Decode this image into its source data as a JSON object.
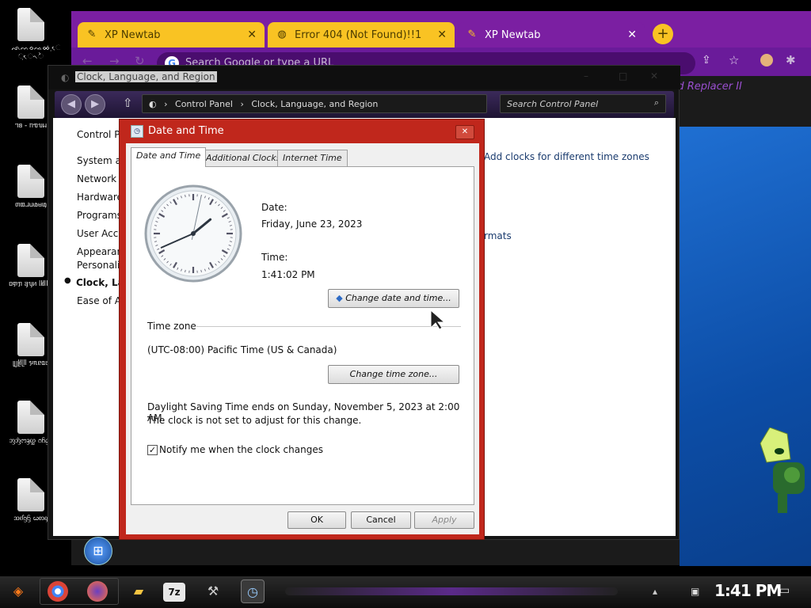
{
  "desktop": {
    "icons": [
      {
        "label": "ᨒᨓᨔᨕᨖ ᨘᨗᨙᨚᨛ"
      },
      {
        "label": "ᥐᥑ - ᥒᥓᥔᥕ"
      },
      {
        "label": "ᥖᥗᥘᥙᥚᥛᥜ"
      },
      {
        "label": "ᥝᥞᥟ ᥠᥡᥢ ᥣᥤᥥᥦᥧ"
      },
      {
        "label": "ᥨᥩᥪᥫᥬ ᥭᥰᥱᥲᥳ"
      },
      {
        "label": "ᦀᦁᦂᦃᦄ ᦅᦆᦇᦈ"
      },
      {
        "label": "ᦉᦊᦋᦌ ᦍᦎᦏ"
      }
    ]
  },
  "browser": {
    "tabs": [
      {
        "label": "XP Newtab",
        "icon": "pencil-icon"
      },
      {
        "label": "Error 404 (Not Found)!!1",
        "icon": "globe-icon"
      },
      {
        "label": "XP Newtab",
        "icon": "pencil-icon"
      }
    ],
    "new_tab_symbol": "+",
    "close_symbol": "✕",
    "omnibox_placeholder": "Search Google or type a URL",
    "extension_text": "rd Replacer II"
  },
  "control_panel": {
    "title": "Clock, Language, and Region",
    "breadcrumb": [
      "Control Panel",
      "Clock, Language, and Region"
    ],
    "search_placeholder": "Search Control Panel",
    "sidebar": [
      "Control Pa",
      "System ar",
      "Network a",
      "Hardware",
      "Programs",
      "User Acco",
      "Appearanc",
      "Personaliz",
      "Clock, Lan",
      "Ease of A"
    ],
    "right_links": [
      "Add clocks for different time zones",
      "rmats"
    ]
  },
  "dialog": {
    "title": "Date and Time",
    "close_symbol": "✕",
    "tabs": [
      "Date and Time",
      "Additional Clocks",
      "Internet Time"
    ],
    "date_label": "Date:",
    "date_value": "Friday, June 23, 2023",
    "time_label": "Time:",
    "time_value": "1:41:02 PM",
    "change_datetime_button": "Change date and time...",
    "timezone_label": "Time zone",
    "timezone_value": "(UTC-08:00) Pacific Time (US & Canada)",
    "change_timezone_button": "Change time zone...",
    "dst_line1": "Daylight Saving Time ends on Sunday, November 5, 2023 at 2:00 AM.",
    "dst_line2": "The clock is not set to adjust for this change.",
    "notify_label": "Notify me when the clock changes",
    "notify_checked": true,
    "ok_button": "OK",
    "cancel_button": "Cancel",
    "apply_button": "Apply"
  },
  "clock": {
    "hour": 1,
    "minute": 41,
    "second": 2
  },
  "taskbar": {
    "time": "1:41 PM",
    "apps": [
      "start-button-icon",
      "chrome-icon",
      "firefox-icon",
      "file-explorer-icon",
      "7zip-icon",
      "wrench-tool-icon",
      "control-panel-icon"
    ],
    "seven_zip_label": "7z"
  },
  "colors": {
    "dialog_frame": "#c0271c",
    "browser_tab_active": "#7b1fa2",
    "browser_tab_inactive": "#f9c323",
    "wallpaper": "#1f6fd2"
  }
}
